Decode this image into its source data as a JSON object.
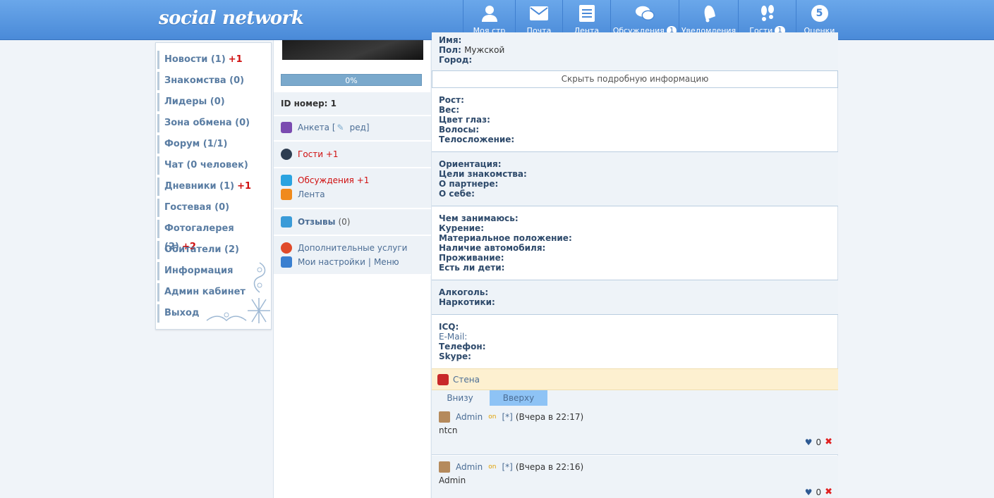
{
  "header": {
    "logo": "social network",
    "nav": [
      {
        "label": "Моя стр",
        "icon": "user-icon",
        "badge": ""
      },
      {
        "label": "Почта",
        "icon": "mail-icon",
        "badge": ""
      },
      {
        "label": "Лента",
        "icon": "feed-icon",
        "badge": ""
      },
      {
        "label": "Обсуждения",
        "icon": "chat-bubbles-icon",
        "badge": "1"
      },
      {
        "label": "Уведомления",
        "icon": "bell-icon",
        "badge": ""
      },
      {
        "label": "Гости",
        "icon": "footprints-icon",
        "badge": "1"
      },
      {
        "label": "Оценки",
        "icon": "rating-icon",
        "badge": "",
        "icon_text": "5"
      }
    ]
  },
  "leftmenu": {
    "items": [
      {
        "label": "Новости (1)",
        "plus": "+1"
      },
      {
        "label": "Знакомства (0)",
        "plus": ""
      },
      {
        "label": "Лидеры (0)",
        "plus": ""
      },
      {
        "label": "Зона обмена (0)",
        "plus": ""
      },
      {
        "label": "Форум (1/1)",
        "plus": ""
      },
      {
        "label": "Чат (0 человек)",
        "plus": ""
      },
      {
        "label": "Дневники (1)",
        "plus": "+1"
      },
      {
        "label": "Гостевая (0)",
        "plus": ""
      },
      {
        "label": "Фотогалерея (2)",
        "plus": "+2"
      },
      {
        "label": "Обитатели (2)",
        "plus": ""
      },
      {
        "label": "Информация",
        "plus": ""
      },
      {
        "label": "Админ кабинет",
        "plus": ""
      },
      {
        "label": "Выход",
        "plus": ""
      }
    ]
  },
  "profile": {
    "progress_label": "0%",
    "progress_value": 0,
    "id_label": "ID номер: 1",
    "anketa": "Анкета [",
    "anketa_edit": "ред]",
    "guests": "Гости +1",
    "discussions": "Обсуждения +1",
    "feed": "Лента",
    "reviews": "Отзывы",
    "reviews_count": "(0)",
    "services": "Дополнительные услуги",
    "settings": "Мои настройки",
    "separator": "|",
    "menu": "Меню"
  },
  "info": {
    "top": [
      {
        "k": "Имя:",
        "v": ""
      },
      {
        "k": "Пол:",
        "v": "Мужской"
      },
      {
        "k": "Город:",
        "v": ""
      }
    ],
    "hide_button": "Скрыть подробную информацию",
    "body": [
      "Рост:",
      "Вес:",
      "Цвет глаз:",
      "Волосы:",
      "Телосложение:"
    ],
    "dating": [
      "Ориентация:",
      "Цели знакомства:",
      "О партнере:",
      "О себе:"
    ],
    "life": [
      "Чем занимаюсь:",
      "Курение:",
      "Материальное положение:",
      "Наличие автомобиля:",
      "Проживание:",
      "Есть ли дети:"
    ],
    "habits": [
      "Алкоголь:",
      "Наркотики:"
    ],
    "contacts": [
      "ICQ:",
      "E-Mail:",
      "Телефон:",
      "Skype:"
    ]
  },
  "wall": {
    "title": "Стена",
    "tab_bottom": "Внизу",
    "tab_top": "Вверху",
    "posts": [
      {
        "author": "Admin",
        "status": "on",
        "star": "[*]",
        "time": "(Вчера в 22:17)",
        "text": "ntcn",
        "likes": "0"
      },
      {
        "author": "Admin",
        "status": "on",
        "star": "[*]",
        "time": "(Вчера в 22:16)",
        "text": "Admin",
        "likes": "0"
      }
    ]
  },
  "colors": {
    "header": "#4a8ad8",
    "link": "#4b6d95",
    "accent_red": "#d01010",
    "wall_bg": "#fdf0d0"
  }
}
